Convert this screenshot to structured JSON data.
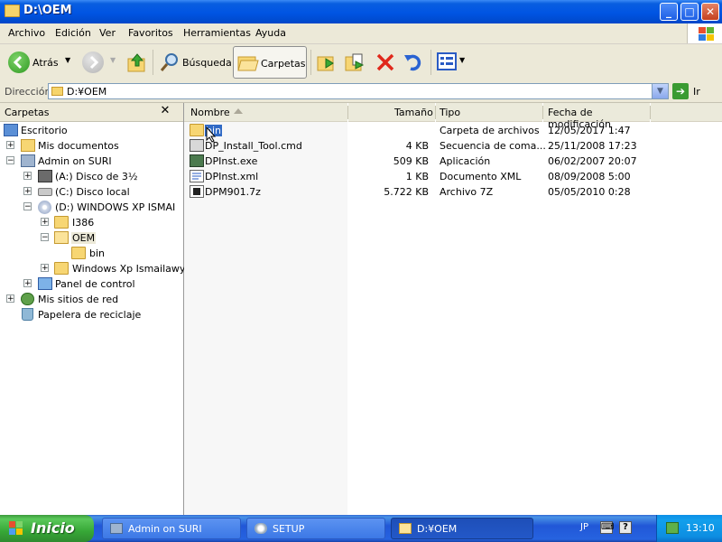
{
  "window": {
    "title": "D:\\OEM"
  },
  "menu": [
    "Archivo",
    "Edición",
    "Ver",
    "Favoritos",
    "Herramientas",
    "Ayuda"
  ],
  "toolbar": {
    "back_label": "Atrás",
    "search_label": "Búsqueda",
    "folders_label": "Carpetas"
  },
  "address": {
    "label": "Dirección",
    "value": "D:¥OEM",
    "go_label": "Ir"
  },
  "folders_pane": {
    "title": "Carpetas",
    "tree": [
      {
        "label": "Escritorio",
        "icon": "desktop-icon"
      },
      {
        "label": "Mis documentos",
        "icon": "documents-icon"
      },
      {
        "label": "Admin on SURI",
        "icon": "computer-icon"
      },
      {
        "label": "(A:) Disco de 3½",
        "icon": "floppy-icon"
      },
      {
        "label": "(C:) Disco local",
        "icon": "drive-icon"
      },
      {
        "label": "(D:) WINDOWS XP ISMAI",
        "icon": "cd-icon"
      },
      {
        "label": "I386",
        "icon": "folder-icon"
      },
      {
        "label": "OEM",
        "icon": "folder-open-icon"
      },
      {
        "label": "bin",
        "icon": "folder-icon"
      },
      {
        "label": "Windows Xp Ismailawy",
        "icon": "folder-icon"
      },
      {
        "label": "Panel de control",
        "icon": "control-panel-icon"
      },
      {
        "label": "Mis sitios de red",
        "icon": "network-icon"
      },
      {
        "label": "Papelera de reciclaje",
        "icon": "recycle-bin-icon"
      }
    ]
  },
  "file_list": {
    "columns": {
      "name": "Nombre",
      "size": "Tamaño",
      "type": "Tipo",
      "modified": "Fecha de modificación"
    },
    "rows": [
      {
        "name": "bin",
        "size": "",
        "type": "Carpeta de archivos",
        "modified": "12/05/2017 1:47",
        "icon": "folder-icon"
      },
      {
        "name": "DP_Install_Tool.cmd",
        "size": "4 KB",
        "type": "Secuencia de coma...",
        "modified": "25/11/2008 17:23",
        "icon": "cmd-icon"
      },
      {
        "name": "DPInst.exe",
        "size": "509 KB",
        "type": "Aplicación",
        "modified": "06/02/2007 20:07",
        "icon": "exe-icon"
      },
      {
        "name": "DPInst.xml",
        "size": "1 KB",
        "type": "Documento XML",
        "modified": "08/09/2008 5:00",
        "icon": "xml-icon"
      },
      {
        "name": "DPM901.7z",
        "size": "5.722 KB",
        "type": "Archivo 7Z",
        "modified": "05/05/2010 0:28",
        "icon": "archive-icon"
      }
    ]
  },
  "taskbar": {
    "start_label": "Inicio",
    "tasks": [
      {
        "label": "Admin on SURI"
      },
      {
        "label": "SETUP"
      },
      {
        "label": "D:¥OEM"
      }
    ],
    "ime_label": "JP",
    "clock": "13:10"
  }
}
